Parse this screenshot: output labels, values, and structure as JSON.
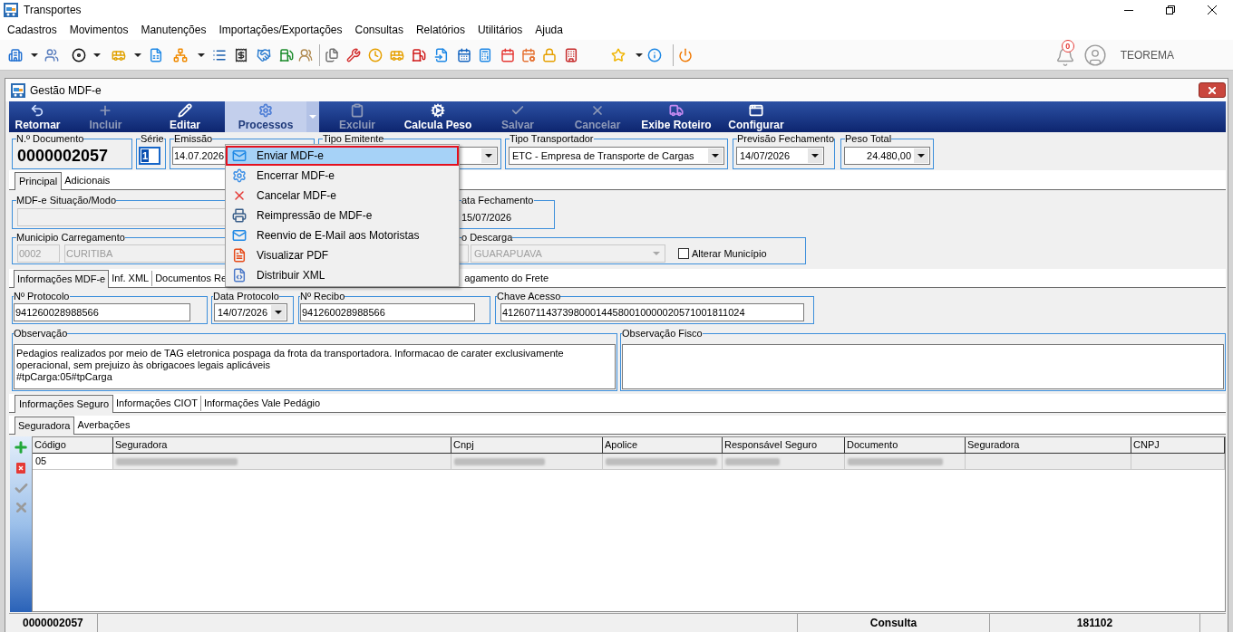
{
  "window": {
    "title": "Transportes"
  },
  "menu_bar": [
    "Cadastros",
    "Movimentos",
    "Manutenções",
    "Importações/Exportações",
    "Consultas",
    "Relatórios",
    "Utilitários",
    "Ajuda"
  ],
  "notifications": {
    "count": "0"
  },
  "user": {
    "name": "TEOREMA"
  },
  "form": {
    "title": "Gestão MDF-e"
  },
  "actions": [
    {
      "label": "Retornar",
      "kind": "button",
      "disabled": false,
      "expanded": false
    },
    {
      "label": "Incluir",
      "kind": "button",
      "disabled": true,
      "expanded": false
    },
    {
      "label": "Editar",
      "kind": "button",
      "disabled": false,
      "expanded": false
    },
    {
      "label": "Processos",
      "kind": "split",
      "disabled": false,
      "expanded": true,
      "menu": [
        {
          "label": "Enviar MDF-e",
          "selected": true
        },
        {
          "label": "Encerrar MDF-e",
          "selected": false
        },
        {
          "label": "Cancelar MDF-e",
          "selected": false
        },
        {
          "label": "Reimpressão de MDF-e",
          "selected": false
        },
        {
          "label": "Reenvio de E-Mail aos Motoristas",
          "selected": false
        },
        {
          "label": "Visualizar PDF",
          "selected": false
        },
        {
          "label": "Distribuir XML",
          "selected": false
        }
      ]
    },
    {
      "label": "Excluir",
      "kind": "button",
      "disabled": true,
      "expanded": false
    },
    {
      "label": "Calcula Peso",
      "kind": "button",
      "disabled": false,
      "expanded": false
    },
    {
      "label": "Salvar",
      "kind": "button",
      "disabled": true,
      "expanded": false
    },
    {
      "label": "Cancelar",
      "kind": "button",
      "disabled": true,
      "expanded": false
    },
    {
      "label": "Exibe Roteiro",
      "kind": "button",
      "disabled": false,
      "expanded": false
    },
    {
      "label": "Configurar",
      "kind": "button",
      "disabled": false,
      "expanded": false
    }
  ],
  "header": [
    {
      "label": "N.º Documento",
      "kind": "number",
      "value": "0000002057",
      "focused": false
    },
    {
      "label": "Série",
      "kind": "input",
      "value": "1",
      "focused": true
    },
    {
      "label": "Emissão",
      "kind": "input",
      "value": "14.07.2026",
      "focused": false
    },
    {
      "label": "Tipo Emitente",
      "kind": "select",
      "focused": false
    },
    {
      "label": "Tipo Transportador",
      "kind": "select",
      "value": "ETC - Empresa de Transporte de Cargas",
      "focused": false
    },
    {
      "label": "Previsão Fechamento",
      "kind": "select",
      "value": "14/07/2026",
      "focused": false
    },
    {
      "label": "Peso Total",
      "kind": "amount",
      "value": "24.480,00",
      "focused": false
    }
  ],
  "main_tabs": [
    {
      "label": "Principal",
      "selected": true
    },
    {
      "label": "Adicionais",
      "selected": false
    }
  ],
  "principal": {
    "situation": {
      "label": "MDF-e Situação/Modo",
      "disabled": true
    },
    "closing_date": {
      "label": "ata Fechamento",
      "value": "15/07/2026"
    },
    "loading_city": {
      "label": "Municipio Carregamento",
      "code": "0002",
      "name": "CURITIBA",
      "disabled": true
    },
    "unloading_city": {
      "label": "o Descarga",
      "name": "GUARAPUAVA",
      "disabled": true,
      "change_city": {
        "label": "Alterar Município",
        "checked": false
      }
    }
  },
  "info_tabs": [
    {
      "label": "Informações MDF-e",
      "selected": true
    },
    {
      "label": "Inf. XML",
      "selected": false
    },
    {
      "label": "Documentos Re",
      "selected": false
    },
    {
      "label": "agamento do Frete",
      "selected": false
    }
  ],
  "protocol_fields": [
    {
      "label": "Nº Protocolo",
      "kind": "input",
      "value": "941260028988566"
    },
    {
      "label": "Data Protocolo",
      "kind": "select",
      "value": "14/07/2026"
    },
    {
      "label": "Nº Recibo",
      "kind": "input",
      "value": "941260028988566"
    },
    {
      "label": "Chave Acesso",
      "kind": "input",
      "value": "41260711437398000144580010000020571001811024"
    }
  ],
  "observation": {
    "label": "Observação",
    "text": "Pedagios realizados por meio de TAG eletronica pospaga da frota da transportadora. Informacao de carater exclusivamente\noperacional, sem prejuizo às obrigacoes legais aplicáveis\n#tpCarga:05#tpCarga"
  },
  "fiscal_observation": {
    "label": "Observação Fisco"
  },
  "insurance_tabs": [
    {
      "label": "Informações Seguro",
      "selected": true
    },
    {
      "label": "Informações CIOT",
      "selected": false
    },
    {
      "label": "Informações Vale Pedágio",
      "selected": false
    }
  ],
  "insurer_tabs": [
    {
      "label": "Seguradora",
      "selected": true
    },
    {
      "label": "Averbações",
      "selected": false
    }
  ],
  "grid_tools": [
    {
      "disabled": false
    },
    {
      "disabled": false
    },
    {
      "disabled": true
    },
    {
      "disabled": true
    }
  ],
  "table": {
    "columns": [
      "Código",
      "Seguradora",
      "Cnpj",
      "Apolice",
      "Responsável Seguro",
      "Documento",
      "Seguradora",
      "CNPJ"
    ],
    "rows": [
      {
        "selected": true,
        "cells": [
          {
            "kind": "text",
            "text": "05"
          },
          {
            "kind": "blurred"
          },
          {
            "kind": "blurred"
          },
          {
            "kind": "blurred"
          },
          {
            "kind": "blurred"
          },
          {
            "kind": "blurred"
          },
          {
            "kind": "empty"
          },
          {
            "kind": "empty"
          }
        ]
      }
    ]
  },
  "status_bar": {
    "panes": [
      "0000002057",
      "Consulta",
      "181102"
    ]
  }
}
